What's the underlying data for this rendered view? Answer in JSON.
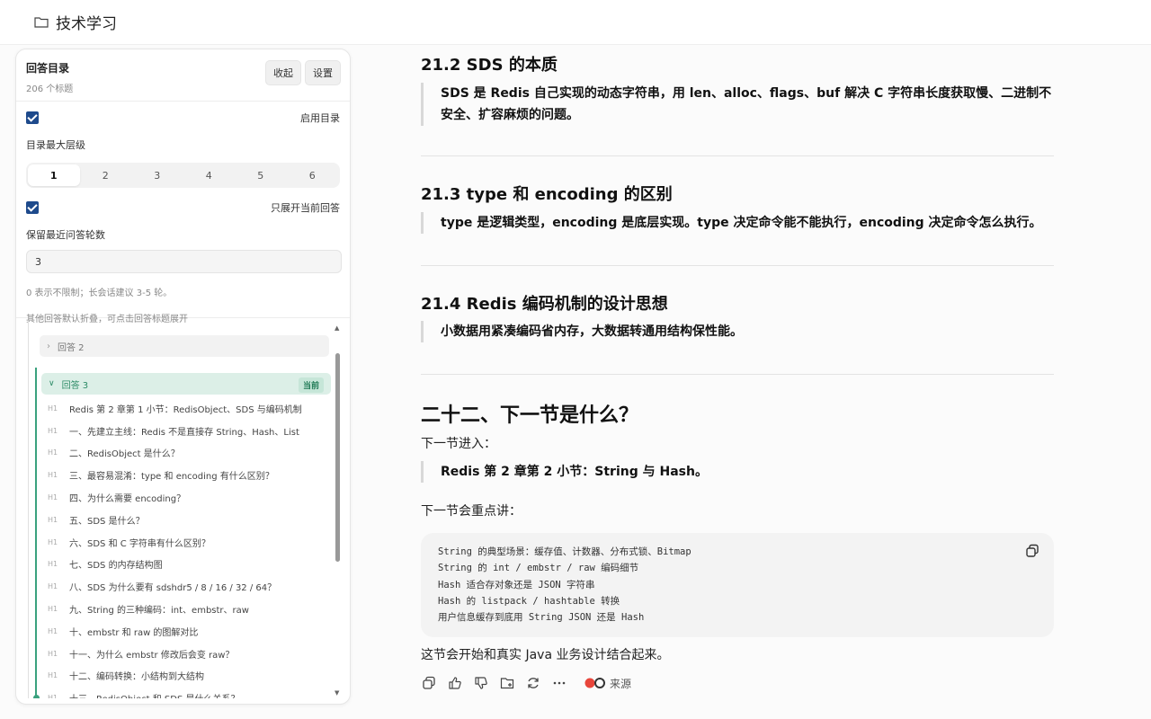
{
  "header": {
    "title": "技术学习"
  },
  "toc": {
    "title": "回答目录",
    "count": "206 个标题",
    "collapse_label": "收起",
    "settings_label": "设置",
    "enable_label": "启用目录",
    "max_level_label": "目录最大层级",
    "levels": [
      "1",
      "2",
      "3",
      "4",
      "5",
      "6"
    ],
    "selected_level": "1",
    "expand_current_label": "只展开当前回答",
    "keep_rounds_label": "保留最近问答轮数",
    "keep_rounds_value": "3",
    "hint1": "0 表示不限制；长会话建议 3-5 轮。",
    "hint2": "其他回答默认折叠，可点击回答标题展开",
    "collapsed_answer": "回答 2",
    "active_answer": "回答 3",
    "current_badge": "当前",
    "heading_tag": "H1",
    "items": [
      "Redis 第 2 章第 1 小节：RedisObject、SDS 与编码机制",
      "一、先建立主线：Redis 不是直接存 String、Hash、List",
      "二、RedisObject 是什么？",
      "三、最容易混淆：type 和 encoding 有什么区别？",
      "四、为什么需要 encoding？",
      "五、SDS 是什么？",
      "六、SDS 和 C 字符串有什么区别？",
      "七、SDS 的内存结构图",
      "八、SDS 为什么要有 sdshdr5 / 8 / 16 / 32 / 64？",
      "九、String 的三种编码：int、embstr、raw",
      "十、embstr 和 raw 的图解对比",
      "十一、为什么 embstr 修改后会变 raw？",
      "十二、编码转换：小结构到大结构",
      "十三、RedisObject 和 SDS 是什么关系？"
    ]
  },
  "content": {
    "s212_title": "21.2 SDS 的本质",
    "s212_quote": "SDS 是 Redis 自己实现的动态字符串，用 len、alloc、flags、buf 解决 C 字符串长度获取慢、二进制不安全、扩容麻烦的问题。",
    "s213_title": "21.3 type 和 encoding 的区别",
    "s213_quote": "type 是逻辑类型，encoding 是底层实现。type 决定命令能不能执行，encoding 决定命令怎么执行。",
    "s214_title": "21.4 Redis 编码机制的设计思想",
    "s214_quote": "小数据用紧凑编码省内存，大数据转通用结构保性能。",
    "s22_title": "二十二、下一节是什么？",
    "next_intro": "下一节进入：",
    "next_quote": "Redis 第 2 章第 2 小节：String 与 Hash。",
    "next_focus": "下一节会重点讲：",
    "code_lines": [
      "String 的典型场景：缓存值、计数器、分布式锁、Bitmap",
      "String 的 int / embstr / raw 编码细节",
      "Hash 适合存对象还是 JSON 字符串",
      "Hash 的 listpack / hashtable 转换",
      "用户信息缓存到底用 String JSON 还是 Hash"
    ],
    "closing": "这节会开始和真实 Java 业务设计结合起来。",
    "source_label": "来源"
  }
}
